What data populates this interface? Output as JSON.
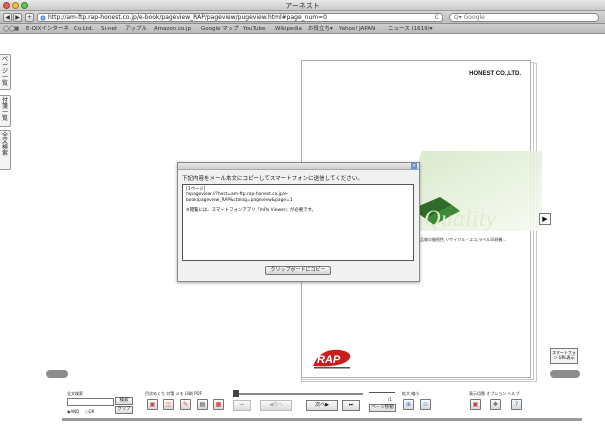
{
  "window": {
    "title": "アーネスト"
  },
  "toolbar": {
    "back": "◀",
    "forward": "▶",
    "add": "+",
    "url": "http://am-ftp.rap-honest.co.jp/e-book/pageview_RAP/pageview/pugeview.html#page_num=0",
    "reload": "C",
    "search_placeholder": "Q▾ Google"
  },
  "bookmarks": [
    "E-QIXインターネ",
    "Co.Ltd.",
    "Si-net",
    "アップル",
    "Amazon.co.jp",
    "Google マップ",
    "YouTube",
    "Wikipedia",
    "お役立ち▾",
    "Yahoo! JAPAN",
    "ニュース (1619)▾"
  ],
  "side_tabs": [
    "ページ一覧",
    "付箋一覧",
    "全文検索"
  ],
  "book": {
    "brand": "HONEST CO.,LTD.",
    "hero_text": "Quality",
    "tagline": "品質の継続性,リサイクル・エコ,ラベル印刷機..."
  },
  "buttons": {
    "next_arrow": "▶",
    "smartphone": "スマートフォン URL表示"
  },
  "dialog": {
    "close": "×",
    "message": "下記内容をメール本文にコピーしてスマートフォンに送信してください。",
    "lines": [
      "[1ページ]",
      "mpageview://?host=am-ftp.rap-honest.co.jp/e-",
      "book/pageview_RAP&ctolog=pageview&page=1",
      "",
      "※閲覧には、スマートフォンアプリ『mPa Viewer』が必要です。"
    ],
    "copy_button": "クリップボードにコピー"
  },
  "bottom": {
    "search_label": "全文検索",
    "search_button": "検索",
    "clear_button": "クリア",
    "and_label": "AND",
    "or_label": "OR",
    "tools_label": "目次めくり 付箋  メモ  印刷  PDF",
    "first": "⏮",
    "prev": "◀前へ",
    "next": "次へ▶",
    "last": "⏭",
    "page_fraction": "/1",
    "page_move": "ページ移動",
    "zoom_label": "拡大  縮小",
    "display_label": "表示切替  オプション  ヘルプ"
  }
}
